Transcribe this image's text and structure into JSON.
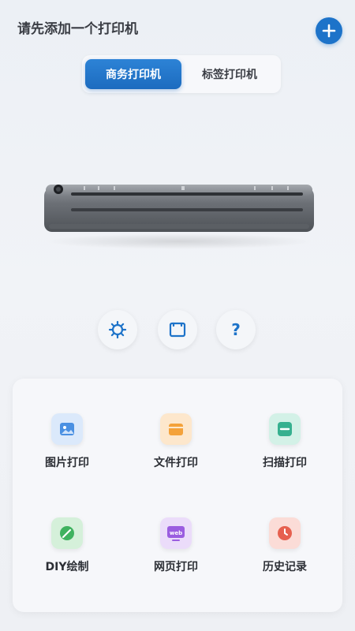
{
  "header": {
    "title": "请先添加一个打印机"
  },
  "tabs": [
    {
      "label": "商务打印机",
      "active": true
    },
    {
      "label": "标签打印机",
      "active": false
    }
  ],
  "toolbar": [
    {
      "icon": "settings-icon"
    },
    {
      "icon": "square-frame-icon"
    },
    {
      "icon": "help-icon",
      "glyph": "?"
    }
  ],
  "functions": [
    {
      "label": "图片打印",
      "icon": "image-icon",
      "color": "#4a90e2"
    },
    {
      "label": "文件打印",
      "icon": "folder-icon",
      "color": "#f4a23a"
    },
    {
      "label": "扫描打印",
      "icon": "scan-icon",
      "color": "#36b08f"
    },
    {
      "label": "DIY绘制",
      "icon": "brush-icon",
      "color": "#3fb25f"
    },
    {
      "label": "网页打印",
      "icon": "web-icon",
      "color": "#9b5de0",
      "badge": "web"
    },
    {
      "label": "历史记录",
      "icon": "clock-icon",
      "color": "#e6604f"
    }
  ],
  "colors": {
    "accent": "#1d73c9"
  }
}
